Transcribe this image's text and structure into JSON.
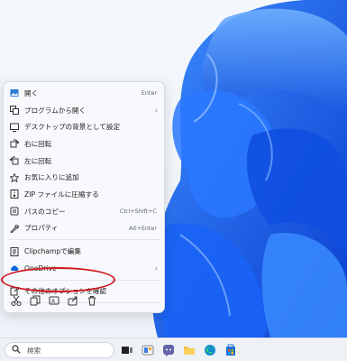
{
  "menu": {
    "items": [
      {
        "label": "開く",
        "shortcut": "Enter",
        "icon": "image-open-icon"
      },
      {
        "label": "プログラムから開く",
        "arrow": "›",
        "icon": "open-with-icon"
      },
      {
        "label": "デスクトップの背景として設定",
        "icon": "desktop-background-icon"
      },
      {
        "label": "右に回転",
        "icon": "rotate-right-icon"
      },
      {
        "label": "左に回転",
        "icon": "rotate-left-icon"
      },
      {
        "label": "お気に入りに追加",
        "icon": "star-icon"
      },
      {
        "label": "ZIP ファイルに圧縮する",
        "icon": "zip-icon"
      },
      {
        "label": "パスのコピー",
        "shortcut": "Ctrl+Shift+C",
        "icon": "copy-path-icon"
      },
      {
        "label": "プロパティ",
        "shortcut": "Alt+Enter",
        "icon": "wrench-icon"
      }
    ],
    "items2": [
      {
        "label": "Clipchampで編集",
        "icon": "clipchamp-icon"
      },
      {
        "label": "OneDrive",
        "arrow": "›",
        "icon": "cloud-icon"
      }
    ],
    "more_options": {
      "label": "その他のオプションを確認",
      "icon": "more-options-icon"
    },
    "bottom_icons": [
      "cut-icon",
      "copy-icon",
      "rename-icon",
      "share-icon",
      "delete-icon"
    ]
  },
  "taskbar": {
    "search_placeholder": "検索",
    "icons": [
      "task-view-icon",
      "widgets-icon",
      "teams-chat-icon",
      "file-explorer-icon",
      "edge-icon",
      "store-icon"
    ]
  },
  "colors": {
    "highlight": "#d1191f",
    "wallpaper": "#1e6ff0"
  }
}
